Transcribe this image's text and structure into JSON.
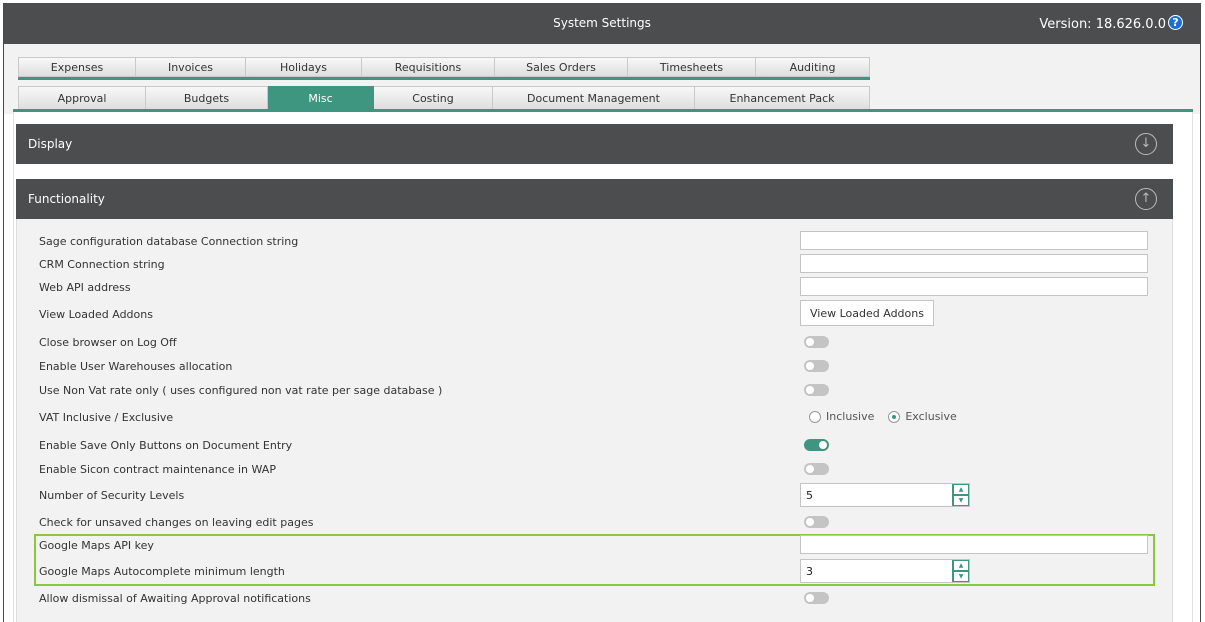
{
  "window": {
    "title": "System Settings",
    "version": "Version: 18.626.0.0",
    "help_glyph": "?"
  },
  "tabs": {
    "row1": [
      "Expenses",
      "Invoices",
      "Holidays",
      "Requisitions",
      "Sales Orders",
      "Timesheets",
      "Auditing"
    ],
    "row2": [
      "Approval",
      "Budgets",
      "Misc",
      "Costing",
      "Document Management",
      "Enhancement Pack"
    ],
    "active": "Misc"
  },
  "sections": {
    "display": {
      "label": "Display",
      "icon": "down-arrow-circle-icon",
      "glyph": "↓",
      "expanded": false
    },
    "functionality": {
      "label": "Functionality",
      "icon": "up-arrow-circle-icon",
      "glyph": "↑",
      "expanded": true
    }
  },
  "settings": {
    "sage_conn": {
      "label": "Sage configuration database Connection string",
      "value": ""
    },
    "crm_conn": {
      "label": "CRM Connection string",
      "value": ""
    },
    "web_api": {
      "label": "Web API address",
      "value": ""
    },
    "view_addons": {
      "label": "View Loaded Addons",
      "button": "View Loaded Addons"
    },
    "close_browser": {
      "label": "Close browser on Log Off",
      "enabled": false
    },
    "user_warehouses": {
      "label": "Enable User Warehouses allocation",
      "enabled": false
    },
    "non_vat": {
      "label": "Use Non Vat rate only  ( uses configured non vat rate per sage database )",
      "enabled": false
    },
    "vat_mode": {
      "label": "VAT Inclusive / Exclusive",
      "options": [
        "Inclusive",
        "Exclusive"
      ],
      "selected": "Exclusive"
    },
    "save_only": {
      "label": "Enable Save Only Buttons on Document Entry",
      "enabled": true
    },
    "sicon_contract": {
      "label": "Enable Sicon contract maintenance in WAP",
      "enabled": false
    },
    "security_levels": {
      "label": "Number of Security Levels",
      "value": "5"
    },
    "unsaved_changes": {
      "label": "Check for unsaved changes on leaving edit pages",
      "enabled": false
    },
    "maps_key": {
      "label": "Google Maps API key",
      "value": ""
    },
    "maps_min": {
      "label": "Google Maps Autocomplete minimum length",
      "value": "3"
    },
    "dismiss_approval": {
      "label": "Allow dismissal of Awaiting Approval notifications",
      "enabled": false
    }
  },
  "colors": {
    "accent": "#3f9680",
    "header": "#4c4d4f",
    "highlight": "#8cc63f"
  }
}
